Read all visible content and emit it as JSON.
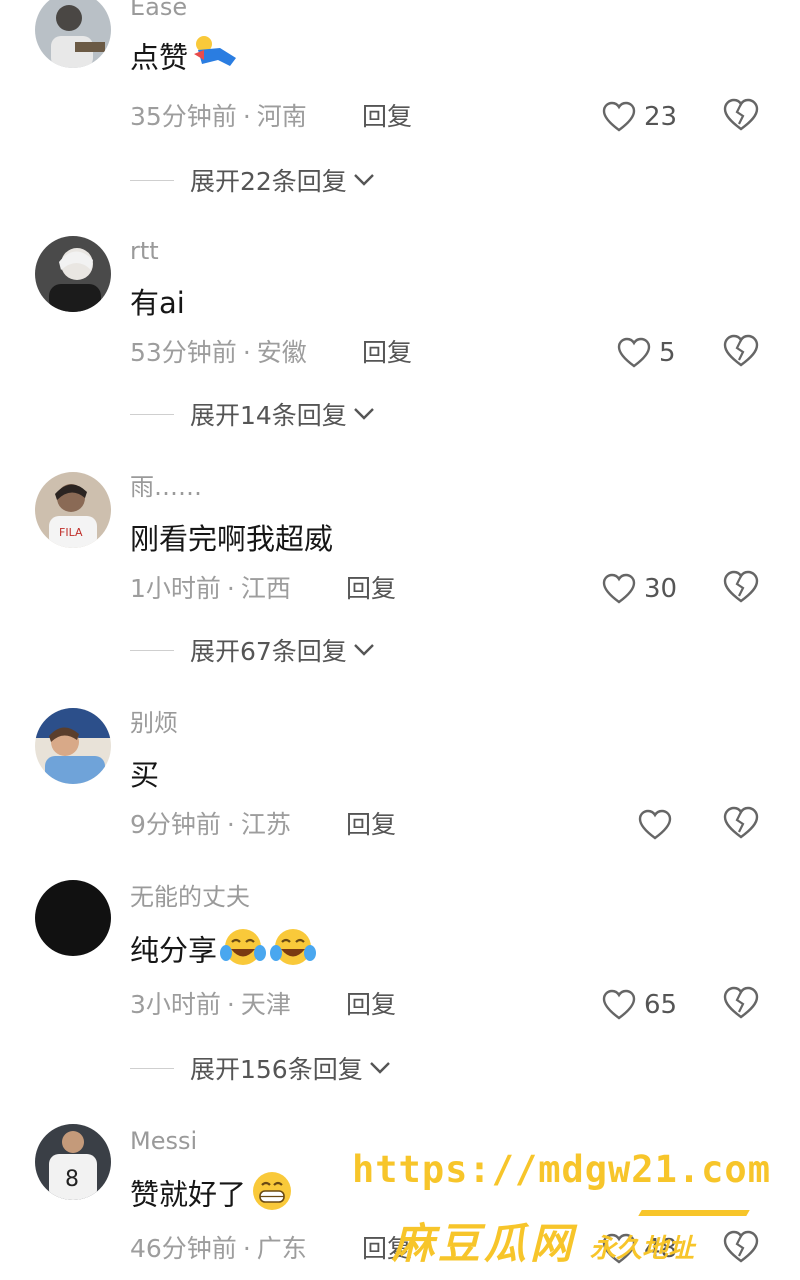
{
  "comments": [
    {
      "user": "Ease",
      "text": "点赞",
      "time": "35分钟前",
      "location": "河南",
      "reply": "回复",
      "likes": "23",
      "expand": "展开22条回复"
    },
    {
      "user": "rtt",
      "text": "有ai",
      "time": "53分钟前",
      "location": "安徽",
      "reply": "回复",
      "likes": "5",
      "expand": "展开14条回复"
    },
    {
      "user": "雨……",
      "text": "刚看完啊我超威",
      "time": "1小时前",
      "location": "江西",
      "reply": "回复",
      "likes": "30",
      "expand": "展开67条回复"
    },
    {
      "user": "别烦",
      "text": "买",
      "time": "9分钟前",
      "location": "江苏",
      "reply": "回复",
      "likes": "",
      "expand": ""
    },
    {
      "user": "无能的丈夫",
      "text": "纯分享",
      "time": "3小时前",
      "location": "天津",
      "reply": "回复",
      "likes": "65",
      "expand": "展开156条回复"
    },
    {
      "user": "Messi",
      "text": "赞就好了",
      "time": "46分钟前",
      "location": "广东",
      "reply": "回复",
      "likes": "48",
      "expand": ""
    }
  ],
  "separator": "·",
  "watermark": {
    "url": "https://mdgw21.com",
    "name": "麻豆瓜网",
    "sub": "永久地址"
  },
  "colors": {
    "accent": "#f7c52a",
    "text": "#161616",
    "muted": "#9d9d9d"
  }
}
